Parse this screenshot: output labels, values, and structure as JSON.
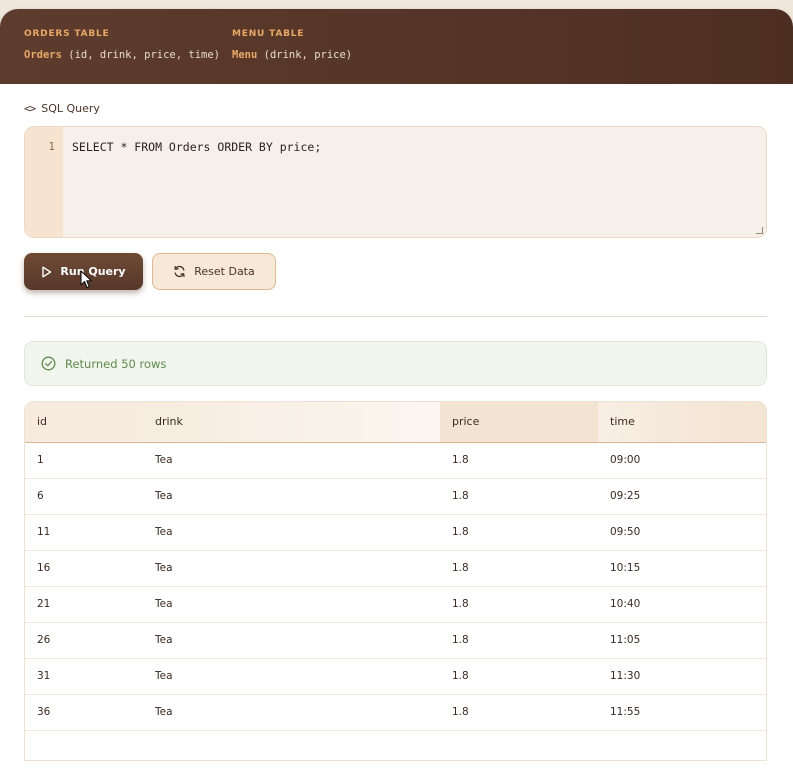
{
  "header": {
    "orders": {
      "title": "ORDERS TABLE",
      "name": "Orders",
      "cols": " (id, drink, price, time)"
    },
    "menu": {
      "title": "MENU TABLE",
      "name": "Menu",
      "cols": " (drink, price)"
    }
  },
  "editor": {
    "label": "SQL Query",
    "icon": "code-icon",
    "line_number": "1",
    "query": "SELECT * FROM Orders ORDER BY price;"
  },
  "buttons": {
    "run_label": "Run Query",
    "run_icon": "play-icon",
    "reset_label": "Reset Data",
    "reset_icon": "refresh-icon"
  },
  "status": {
    "text": "Returned 50 rows",
    "icon": "check-circle-icon",
    "color": "#5f8a4d"
  },
  "table": {
    "columns": [
      "id",
      "drink",
      "price",
      "time"
    ],
    "rows": [
      [
        "1",
        "Tea",
        "1.8",
        "09:00"
      ],
      [
        "6",
        "Tea",
        "1.8",
        "09:25"
      ],
      [
        "11",
        "Tea",
        "1.8",
        "09:50"
      ],
      [
        "16",
        "Tea",
        "1.8",
        "10:15"
      ],
      [
        "21",
        "Tea",
        "1.8",
        "10:40"
      ],
      [
        "26",
        "Tea",
        "1.8",
        "11:05"
      ],
      [
        "31",
        "Tea",
        "1.8",
        "11:30"
      ],
      [
        "36",
        "Tea",
        "1.8",
        "11:55"
      ]
    ]
  },
  "colors": {
    "header_bg": "#5e3c2d",
    "accent": "#e8a866",
    "run_button": "#6f4a35",
    "success": "#5f8a4d"
  }
}
